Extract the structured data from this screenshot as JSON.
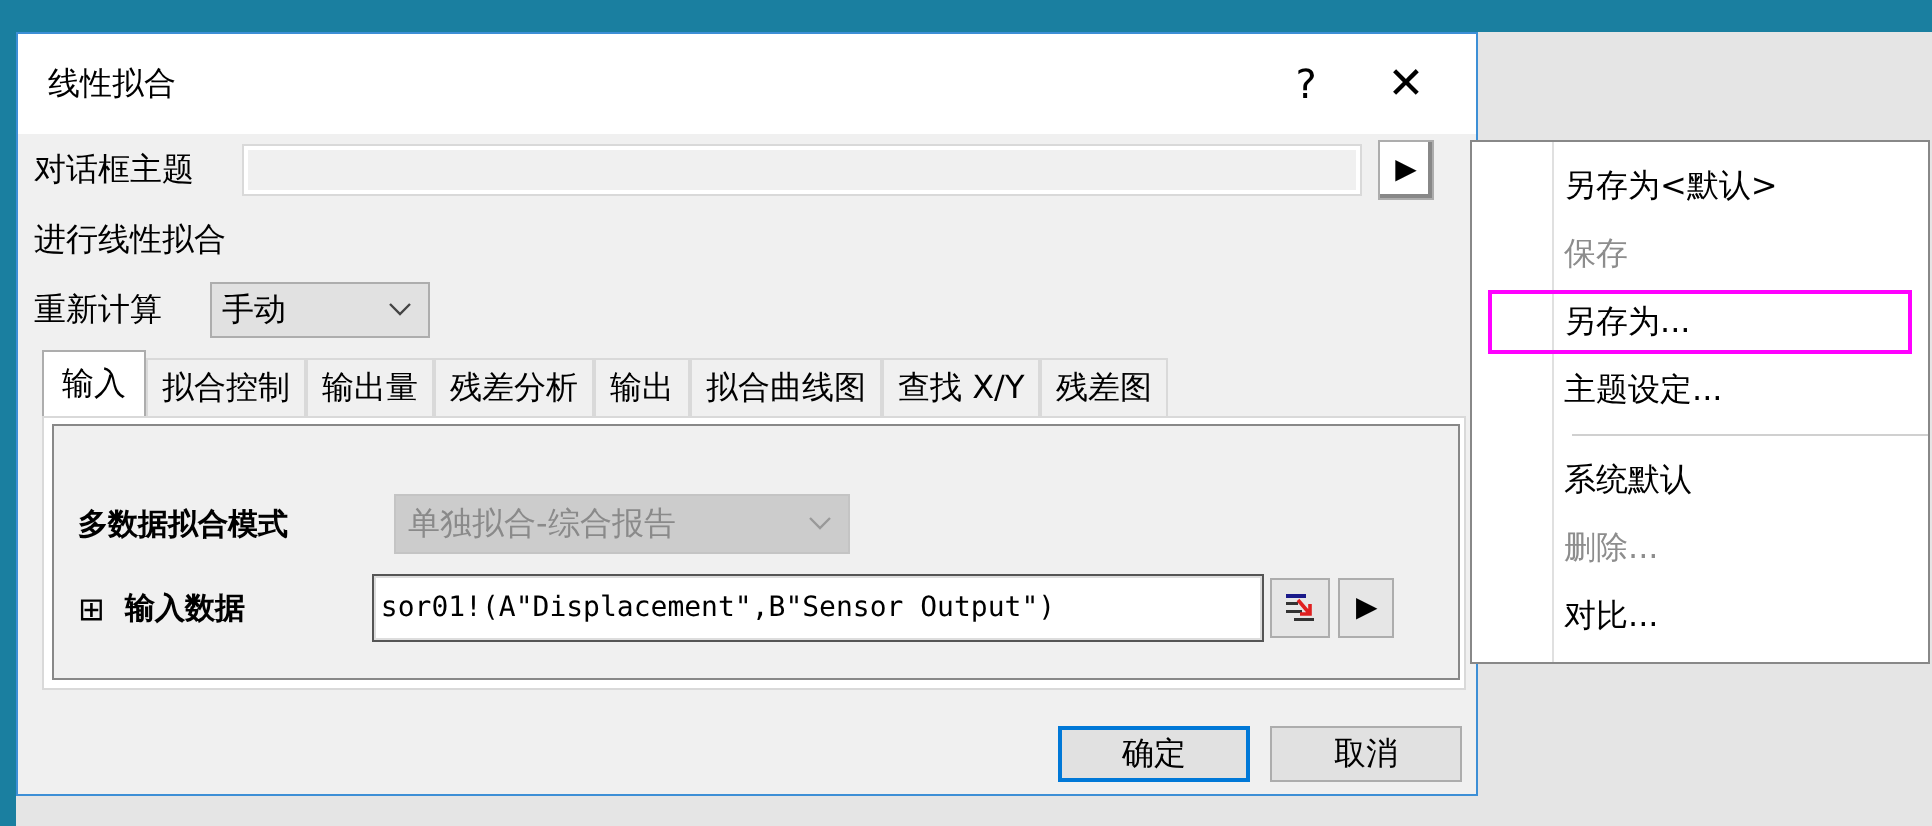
{
  "window": {
    "title": "线性拟合",
    "help_button": "?",
    "close_button": "✕"
  },
  "theme_row": {
    "label": "对话框主题",
    "menu_button": "▶"
  },
  "description": "进行线性拟合",
  "recalculate": {
    "label": "重新计算",
    "value": "手动"
  },
  "tabs": [
    {
      "label": "输入",
      "selected": true
    },
    {
      "label": "拟合控制",
      "selected": false
    },
    {
      "label": "输出量",
      "selected": false
    },
    {
      "label": "残差分析",
      "selected": false
    },
    {
      "label": "输出",
      "selected": false
    },
    {
      "label": "拟合曲线图",
      "selected": false
    },
    {
      "label": "查找 X/Y",
      "selected": false
    },
    {
      "label": "残差图",
      "selected": false
    }
  ],
  "input_tab": {
    "mode_label": "多数据拟合模式",
    "mode_value": "单独拟合-综合报告",
    "mode_disabled": true,
    "data_expand": "⊞",
    "data_label": "输入数据",
    "data_value": "sor01!(A\"Displacement\",B\"Sensor Output\")",
    "data_menu_button": "▶"
  },
  "buttons": [
    {
      "label": "确定",
      "default": true
    },
    {
      "label": "取消",
      "default": false
    }
  ],
  "theme_menu": [
    {
      "kind": "item",
      "label": "另存为<默认>",
      "disabled": false,
      "highlighted": false
    },
    {
      "kind": "item",
      "label": "保存",
      "disabled": true,
      "highlighted": false
    },
    {
      "kind": "item",
      "label": "另存为...",
      "disabled": false,
      "highlighted": true
    },
    {
      "kind": "item",
      "label": "主题设定...",
      "disabled": false,
      "highlighted": false
    },
    {
      "kind": "separator"
    },
    {
      "kind": "item",
      "label": "系统默认",
      "disabled": false,
      "highlighted": false
    },
    {
      "kind": "item",
      "label": "删除...",
      "disabled": true,
      "highlighted": false
    },
    {
      "kind": "item",
      "label": "对比...",
      "disabled": false,
      "highlighted": false
    }
  ]
}
